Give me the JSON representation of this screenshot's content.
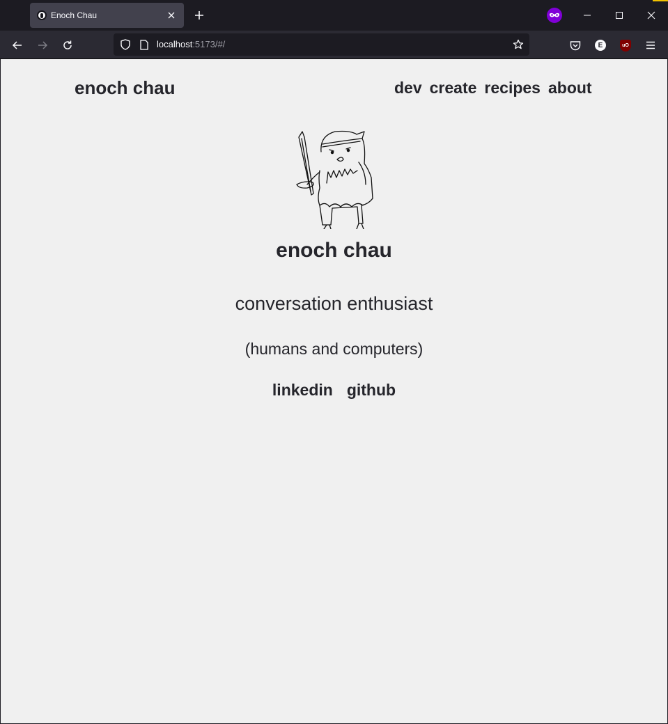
{
  "browser": {
    "tab_title": "Enoch Chau",
    "url_host": "localhost",
    "url_rest": ":5173/#/"
  },
  "site": {
    "brand": "enoch chau",
    "nav": [
      "dev",
      "create",
      "recipes",
      "about"
    ]
  },
  "hero": {
    "name": "enoch chau",
    "tagline": "conversation enthusiast",
    "subtagline": "(humans and computers)",
    "links": [
      "linkedin",
      "github"
    ]
  },
  "icons": {
    "mascot": "owl-with-sword-drawing",
    "private_mode": "private-browsing-mask-icon",
    "extensions": [
      "pocket-icon",
      "extension-e-icon",
      "ublock-icon"
    ]
  },
  "colors": {
    "page_bg": "#f0f0f0",
    "text": "#25252b",
    "chrome_dark": "#1c1b22",
    "toolbar": "#2b2a33",
    "private_purple": "#8000d7"
  }
}
